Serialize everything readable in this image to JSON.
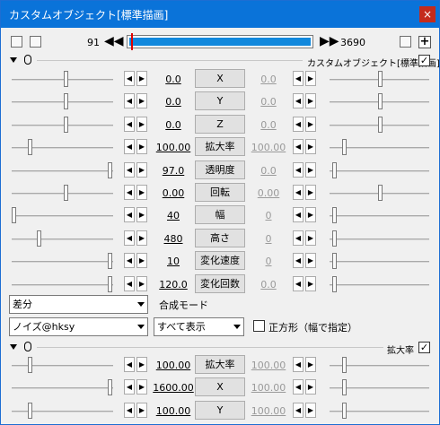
{
  "window": {
    "title": "カスタムオブジェクト[標準描画]",
    "close_label": "×"
  },
  "timeline": {
    "start": "91",
    "end": "3690",
    "prev_label": "◀◀",
    "next_label": "▶▶",
    "add_label": "+"
  },
  "group1": {
    "label": "カスタムオブジェクト[標準描画]",
    "checked": "✓"
  },
  "params": [
    {
      "name": "X",
      "start": "0.0",
      "end": "0.0"
    },
    {
      "name": "Y",
      "start": "0.0",
      "end": "0.0"
    },
    {
      "name": "Z",
      "start": "0.0",
      "end": "0.0"
    },
    {
      "name": "拡大率",
      "start": "100.00",
      "end": "100.00"
    },
    {
      "name": "透明度",
      "start": "97.0",
      "end": "0.0"
    },
    {
      "name": "回転",
      "start": "0.00",
      "end": "0.00"
    },
    {
      "name": "幅",
      "start": "40",
      "end": "0"
    },
    {
      "name": "高さ",
      "start": "480",
      "end": "0"
    },
    {
      "name": "変化速度",
      "start": "10",
      "end": "0"
    },
    {
      "name": "変化回数",
      "start": "120.0",
      "end": "0.0"
    }
  ],
  "spin": {
    "left": "◀",
    "right": "▶"
  },
  "blend": {
    "value": "差分",
    "label": "合成モード"
  },
  "custom": {
    "object_value": "ノイズ@hksy",
    "display_value": "すべて表示",
    "square_label": "正方形（幅で指定）"
  },
  "group2": {
    "label": "拡大率",
    "checked": "✓",
    "params": [
      {
        "name": "拡大率",
        "start": "100.00",
        "end": "100.00"
      },
      {
        "name": "X",
        "start": "1600.00",
        "end": "100.00"
      },
      {
        "name": "Y",
        "start": "100.00",
        "end": "100.00"
      }
    ]
  }
}
